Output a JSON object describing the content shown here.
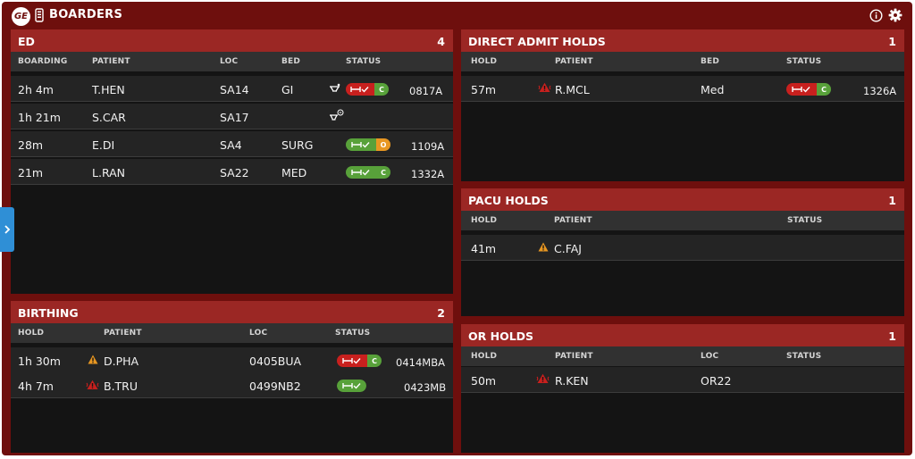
{
  "app": {
    "title": "BOARDERS",
    "logo_text": "GE",
    "icons": [
      "ge-logo",
      "phone-icon",
      "info-icon",
      "gear-icon",
      "chevron-right-icon"
    ]
  },
  "colors": {
    "app_background": "#6e0f0d",
    "panel_header": "#9b2724",
    "panel_body": "#141414",
    "column_header": "#313131",
    "row": "#242424",
    "status_red": "#c8201e",
    "status_green": "#58a13a",
    "status_orange": "#e89722",
    "side_tab": "#2f8fd6"
  },
  "panels": {
    "ed": {
      "title": "ED",
      "count": "4",
      "columns": [
        "BOARDING",
        "PATIENT",
        "LOC",
        "BED",
        "STATUS"
      ],
      "rows": [
        {
          "time": "2h 4m",
          "patient": "T.HEN",
          "loc": "SA14",
          "bed": "GI",
          "status_icon": "transport-icon",
          "bed_status": "red",
          "status_letter": "C",
          "status_letter_color": "green",
          "room": "0817A"
        },
        {
          "time": "1h 21m",
          "patient": "S.CAR",
          "loc": "SA17",
          "bed": "",
          "status_icon": "transport-pending-icon",
          "bed_status": "",
          "status_letter": "",
          "status_letter_color": "",
          "room": ""
        },
        {
          "time": "28m",
          "patient": "E.DI",
          "loc": "SA4",
          "bed": "SURG",
          "status_icon": "",
          "bed_status": "green",
          "status_letter": "O",
          "status_letter_color": "orange",
          "room": "1109A"
        },
        {
          "time": "21m",
          "patient": "L.RAN",
          "loc": "SA22",
          "bed": "MED",
          "status_icon": "",
          "bed_status": "green",
          "status_letter": "C",
          "status_letter_color": "green",
          "room": "1332A"
        }
      ]
    },
    "birthing": {
      "title": "BIRTHING",
      "count": "2",
      "columns": [
        "HOLD",
        "PATIENT",
        "LOC",
        "STATUS"
      ],
      "rows": [
        {
          "time": "1h 30m",
          "alert": "warning-icon",
          "patient": "D.PHA",
          "loc": "0405BUA",
          "bed_status": "red",
          "status_letter": "C",
          "status_letter_color": "green",
          "room": "0414MBA"
        },
        {
          "time": "4h 7m",
          "alert": "critical-alert-icon",
          "patient": "B.TRU",
          "loc": "0499NB2",
          "bed_status": "green",
          "status_letter": "",
          "status_letter_color": "",
          "room": "0423MB"
        }
      ]
    },
    "direct_admit": {
      "title": "DIRECT ADMIT HOLDS",
      "count": "1",
      "columns": [
        "HOLD",
        "PATIENT",
        "BED",
        "STATUS"
      ],
      "rows": [
        {
          "time": "57m",
          "alert": "critical-alert-icon",
          "patient": "R.MCL",
          "bed": "Med",
          "bed_status": "red",
          "status_letter": "C",
          "status_letter_color": "green",
          "room": "1326A"
        }
      ]
    },
    "pacu": {
      "title": "PACU HOLDS",
      "count": "1",
      "columns": [
        "HOLD",
        "PATIENT",
        "STATUS"
      ],
      "rows": [
        {
          "time": "41m",
          "alert": "warning-icon",
          "patient": "C.FAJ"
        }
      ]
    },
    "or": {
      "title": "OR HOLDS",
      "count": "1",
      "columns": [
        "HOLD",
        "PATIENT",
        "LOC",
        "STATUS"
      ],
      "rows": [
        {
          "time": "50m",
          "alert": "critical-alert-icon",
          "patient": "R.KEN",
          "loc": "OR22"
        }
      ]
    }
  }
}
